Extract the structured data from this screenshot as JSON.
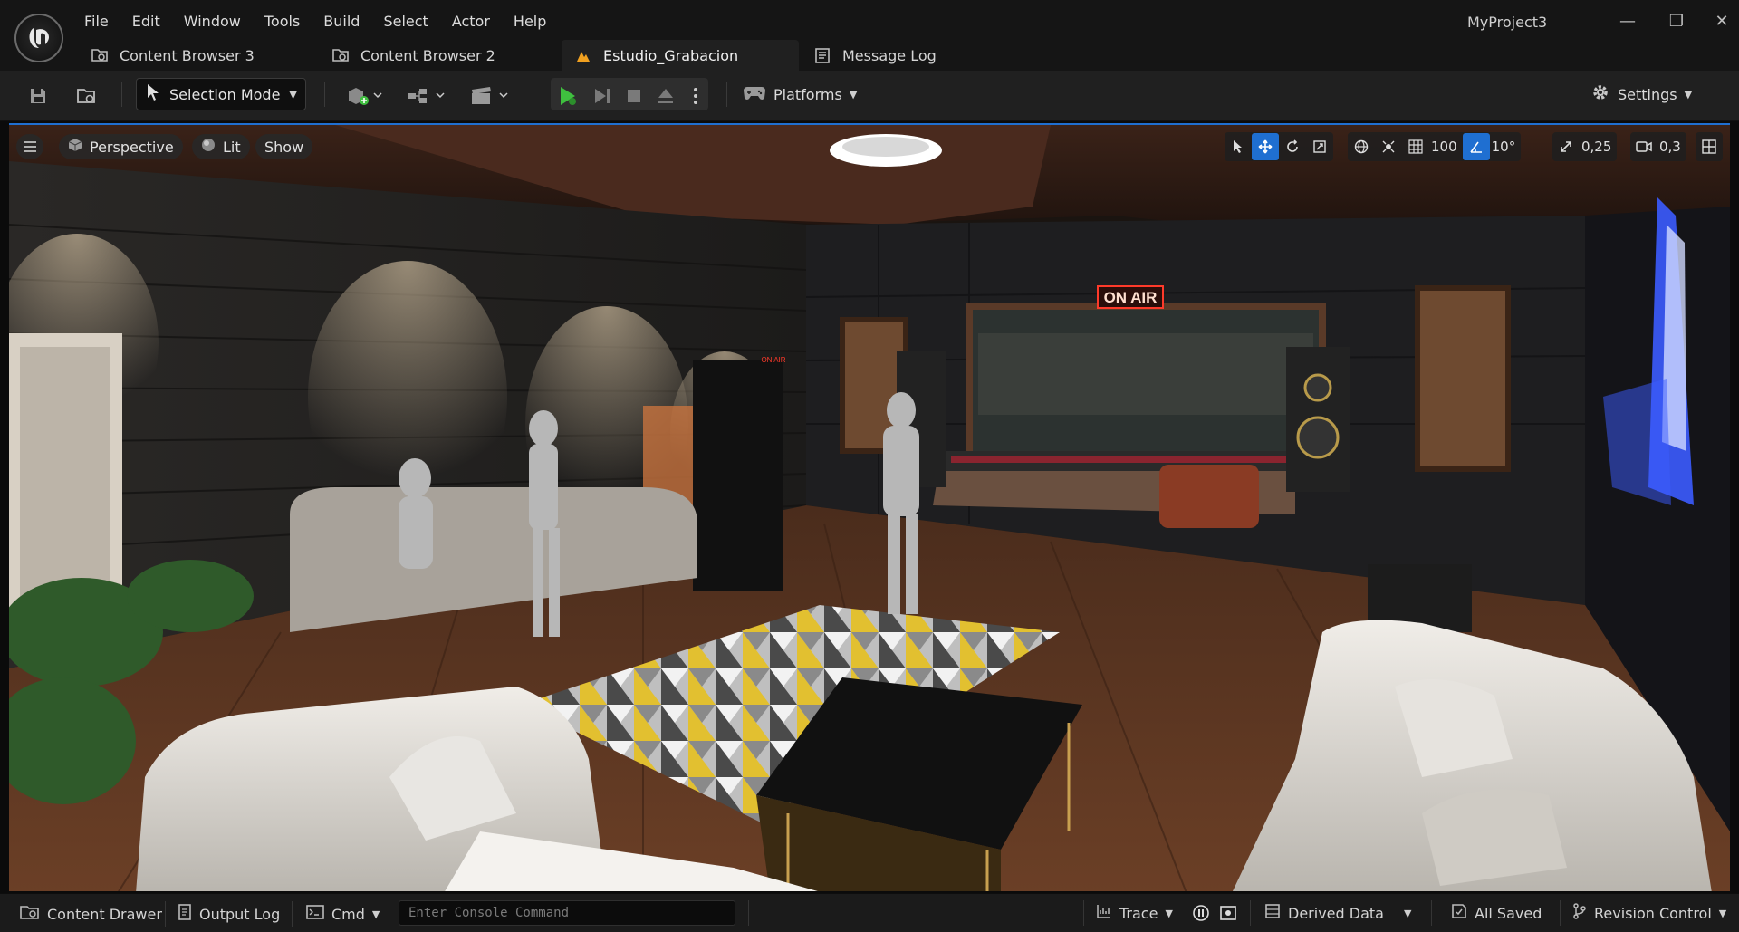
{
  "menu": {
    "items": [
      {
        "label": "File"
      },
      {
        "label": "Edit"
      },
      {
        "label": "Window"
      },
      {
        "label": "Tools"
      },
      {
        "label": "Build"
      },
      {
        "label": "Select"
      },
      {
        "label": "Actor"
      },
      {
        "label": "Help"
      }
    ]
  },
  "project_name": "MyProject3",
  "tabs": [
    {
      "label": "Content Browser 3",
      "icon": "content-browser-icon"
    },
    {
      "label": "Content Browser 2",
      "icon": "content-browser-icon"
    },
    {
      "label": "Estudio_Grabacion",
      "icon": "level-icon",
      "active": true
    },
    {
      "label": "Message Log",
      "icon": "message-log-icon"
    }
  ],
  "toolbar": {
    "selection_mode": "Selection Mode",
    "platforms": "Platforms",
    "settings": "Settings"
  },
  "viewport": {
    "perspective": "Perspective",
    "lit": "Lit",
    "show": "Show",
    "grid_snap": "100",
    "rotation_snap": "10°",
    "scale_snap": "0,25",
    "camera_speed": "0,3",
    "scene_signs": {
      "on_air_big": "ON AIR",
      "on_air_small": "ON AIR"
    }
  },
  "statusbar": {
    "content_drawer": "Content Drawer",
    "output_log": "Output Log",
    "cmd": "Cmd",
    "console_placeholder": "Enter Console Command",
    "trace": "Trace",
    "derived_data": "Derived Data",
    "all_saved": "All Saved",
    "revision_control": "Revision Control"
  },
  "colors": {
    "accent": "#1f6fd1",
    "play_green": "#3fbf3f",
    "on_air_red": "#ff3a2a",
    "neon_blue": "#3b5bff"
  }
}
